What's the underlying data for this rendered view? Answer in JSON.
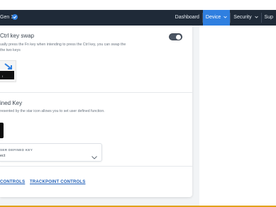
{
  "header": {
    "device_name": "Gen 1",
    "nav": [
      {
        "label": "Dashboard",
        "active": false,
        "has_chevron": false
      },
      {
        "label": "Device",
        "active": true,
        "has_chevron": true
      },
      {
        "label": "Security",
        "active": false,
        "has_chevron": true
      },
      {
        "label": "Sup",
        "active": false,
        "has_chevron": false
      }
    ]
  },
  "ctrl_swap": {
    "title": "Ctrl key swap",
    "desc_line1": "ually press the Fn key when intending to press the Ctrl key, you can swap the",
    "desc_line2": "the two keys",
    "toggle_state": "on",
    "key_label": "l"
  },
  "user_defined": {
    "title": "ined Key",
    "desc": "resented by the star icon allows you to set user defined function.",
    "select_label": "SER DEFINED KEY",
    "select_value": "ect"
  },
  "links": {
    "keyboard_controls": "CONTROLS",
    "trackpoint_controls": "TRACKPOINT CONTROLS"
  },
  "colors": {
    "nav_bg": "#1f2a38",
    "accent": "#2f7fe0",
    "link": "#1f5fb8",
    "border_top_bottom": "#e2a21a"
  }
}
